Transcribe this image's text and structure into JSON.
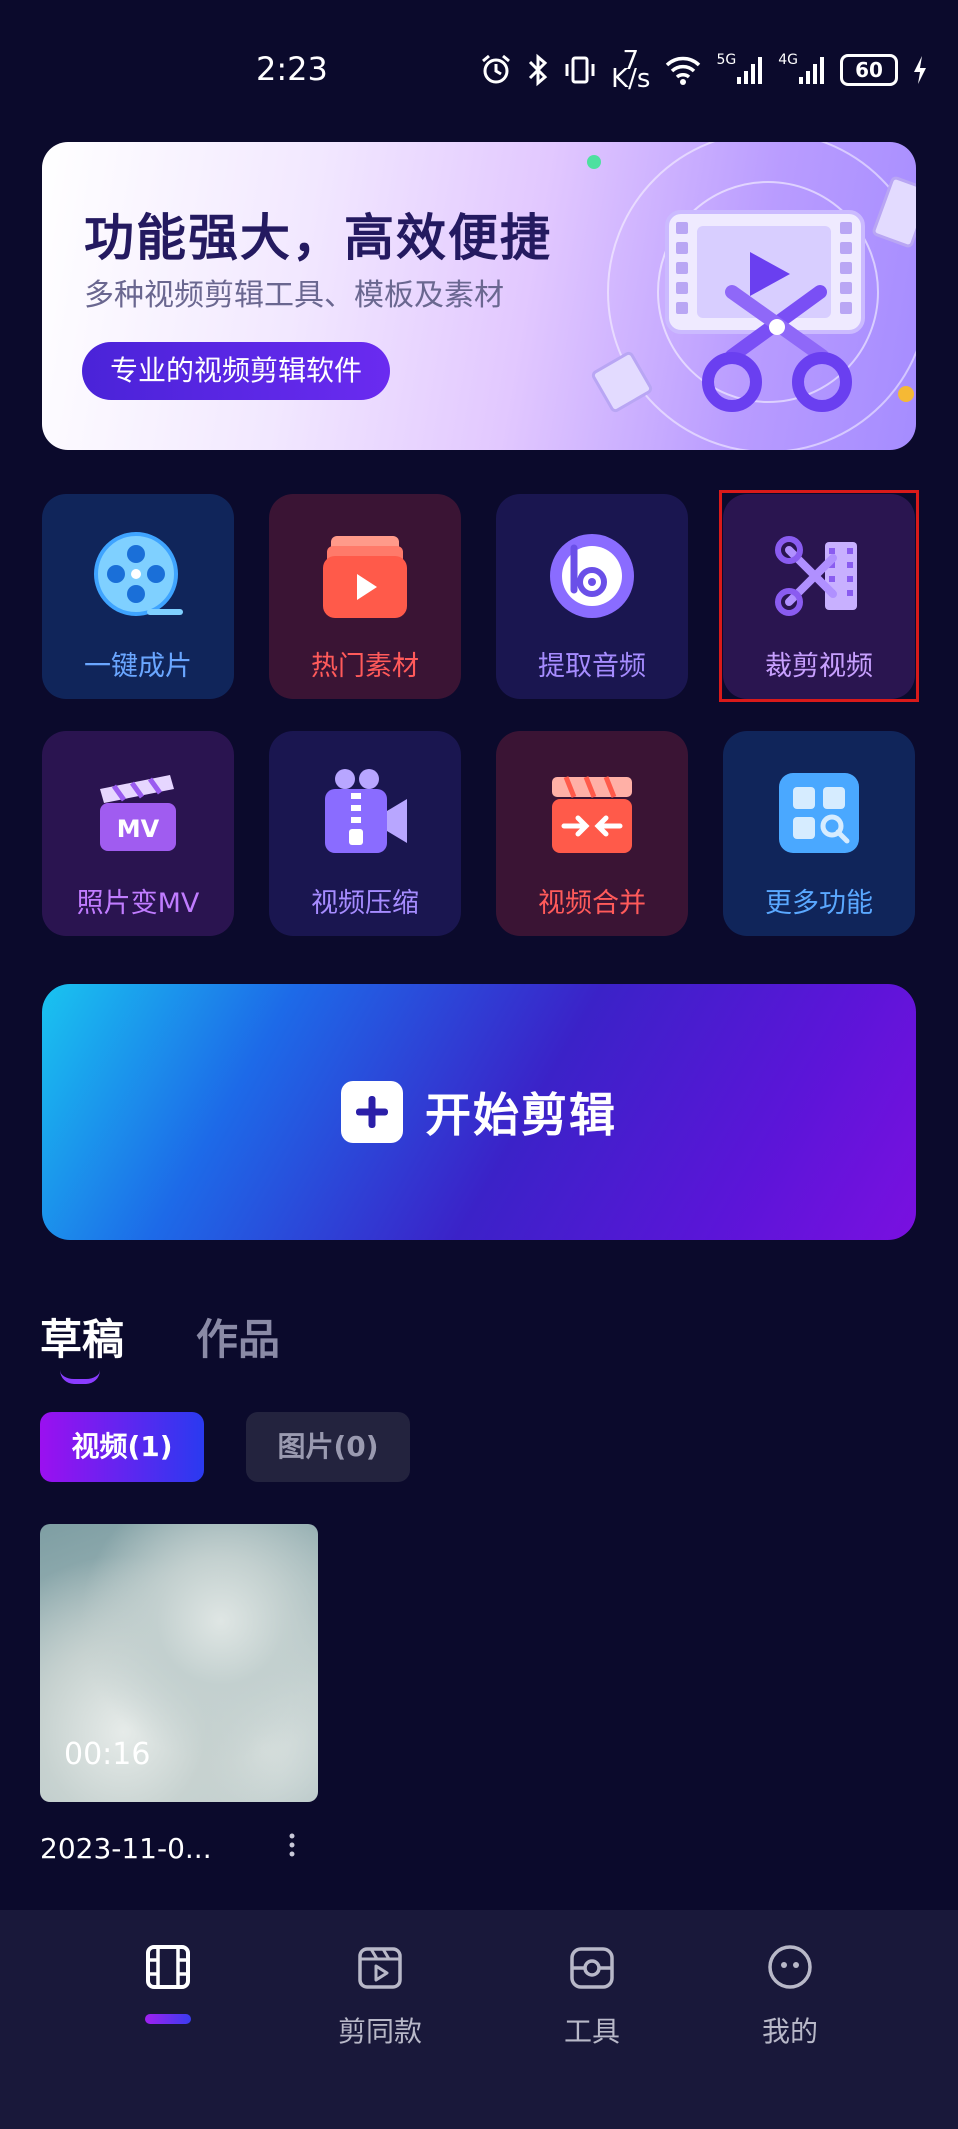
{
  "status_bar": {
    "time": "2:23",
    "net_speed_value": "7",
    "net_speed_unit": "K/s",
    "sim1": "5G",
    "sim2": "4G",
    "battery": "60"
  },
  "banner": {
    "title": "功能强大，高效便捷",
    "subtitle": "多种视频剪辑工具、模板及素材",
    "button": "专业的视频剪辑软件"
  },
  "features": [
    {
      "label": "一键成片",
      "icon": "film-reel-icon",
      "color": "#6aa6ff"
    },
    {
      "label": "热门素材",
      "icon": "play-cards-icon",
      "color": "#ff5a5a"
    },
    {
      "label": "提取音频",
      "icon": "audio-extract-icon",
      "color": "#a68cff"
    },
    {
      "label": "裁剪视频",
      "icon": "scissors-film-icon",
      "color": "#c8a0ff"
    },
    {
      "label": "照片变MV",
      "icon": "mv-clapper-icon",
      "color": "#c07cff"
    },
    {
      "label": "视频压缩",
      "icon": "zip-camera-icon",
      "color": "#a68cff"
    },
    {
      "label": "视频合并",
      "icon": "merge-clapper-icon",
      "color": "#ff5a5a"
    },
    {
      "label": "更多功能",
      "icon": "more-apps-icon",
      "color": "#5aa8ff"
    }
  ],
  "start_edit": {
    "label": "开始剪辑"
  },
  "tabs": [
    {
      "label": "草稿",
      "active": true
    },
    {
      "label": "作品",
      "active": false
    }
  ],
  "filters": [
    {
      "label": "视频(1)",
      "active": true
    },
    {
      "label": "图片(0)",
      "active": false
    }
  ],
  "drafts": [
    {
      "duration": "00:16",
      "date": "2023-11-0..."
    }
  ],
  "bottom_nav": [
    {
      "label": "",
      "icon": "film-frame-icon",
      "active": true
    },
    {
      "label": "剪同款",
      "icon": "clapper-play-icon",
      "active": false
    },
    {
      "label": "工具",
      "icon": "toolbox-icon",
      "active": false
    },
    {
      "label": "我的",
      "icon": "face-icon",
      "active": false
    }
  ]
}
